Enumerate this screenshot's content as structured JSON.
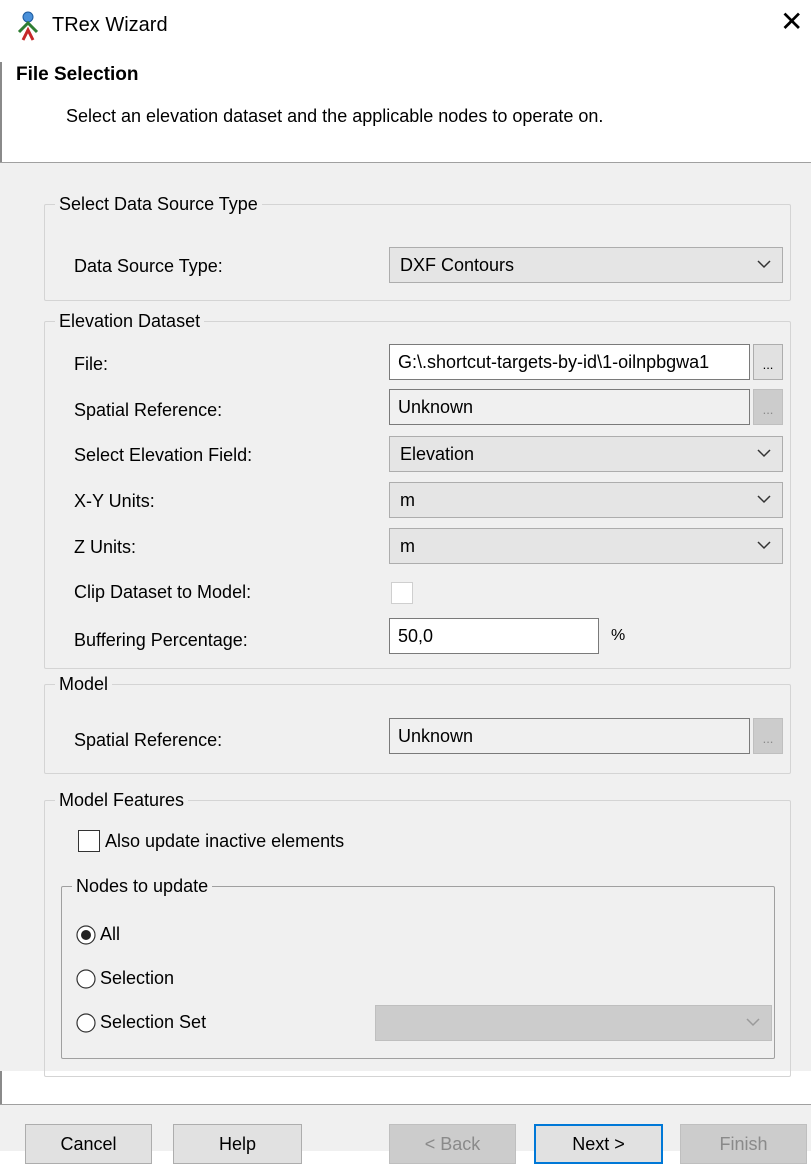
{
  "window": {
    "title": "TRex Wizard",
    "close": "✕"
  },
  "header": {
    "title": "File Selection",
    "description": "Select an elevation dataset and the applicable nodes to operate on."
  },
  "data_source_group": {
    "legend": "Select Data Source Type",
    "type_label": "Data Source Type:",
    "type_value": "DXF Contours"
  },
  "elevation_group": {
    "legend": "Elevation Dataset",
    "file_label": "File:",
    "file_value": "G:\\.shortcut-targets-by-id\\1-oilnpbgwa1",
    "browse_label": "...",
    "spatial_ref_label": "Spatial Reference:",
    "spatial_ref_value": "Unknown",
    "elev_field_label": "Select Elevation Field:",
    "elev_field_value": "Elevation",
    "xy_units_label": "X-Y Units:",
    "xy_units_value": "m",
    "z_units_label": "Z Units:",
    "z_units_value": "m",
    "clip_label": "Clip Dataset to Model:",
    "clip_checked": false,
    "buffer_label": "Buffering Percentage:",
    "buffer_value": "50,0",
    "buffer_unit": "%"
  },
  "model_group": {
    "legend": "Model",
    "spatial_ref_label": "Spatial Reference:",
    "spatial_ref_value": "Unknown",
    "browse_label": "..."
  },
  "features_group": {
    "legend": "Model Features",
    "inactive_label": "Also update inactive elements",
    "inactive_checked": false,
    "nodes": {
      "legend": "Nodes to update",
      "options": [
        "All",
        "Selection",
        "Selection Set"
      ],
      "selected": "All",
      "selection_set_value": ""
    }
  },
  "footer": {
    "cancel": "Cancel",
    "help": "Help",
    "back": "< Back",
    "next": "Next >",
    "finish": "Finish"
  },
  "colors": {
    "accent": "#0078d7",
    "panel": "#f0f0f0",
    "disabled": "#cccccc"
  },
  "icons": {
    "app": "trex-person-icon",
    "dropdown": "chevron-down-icon"
  }
}
